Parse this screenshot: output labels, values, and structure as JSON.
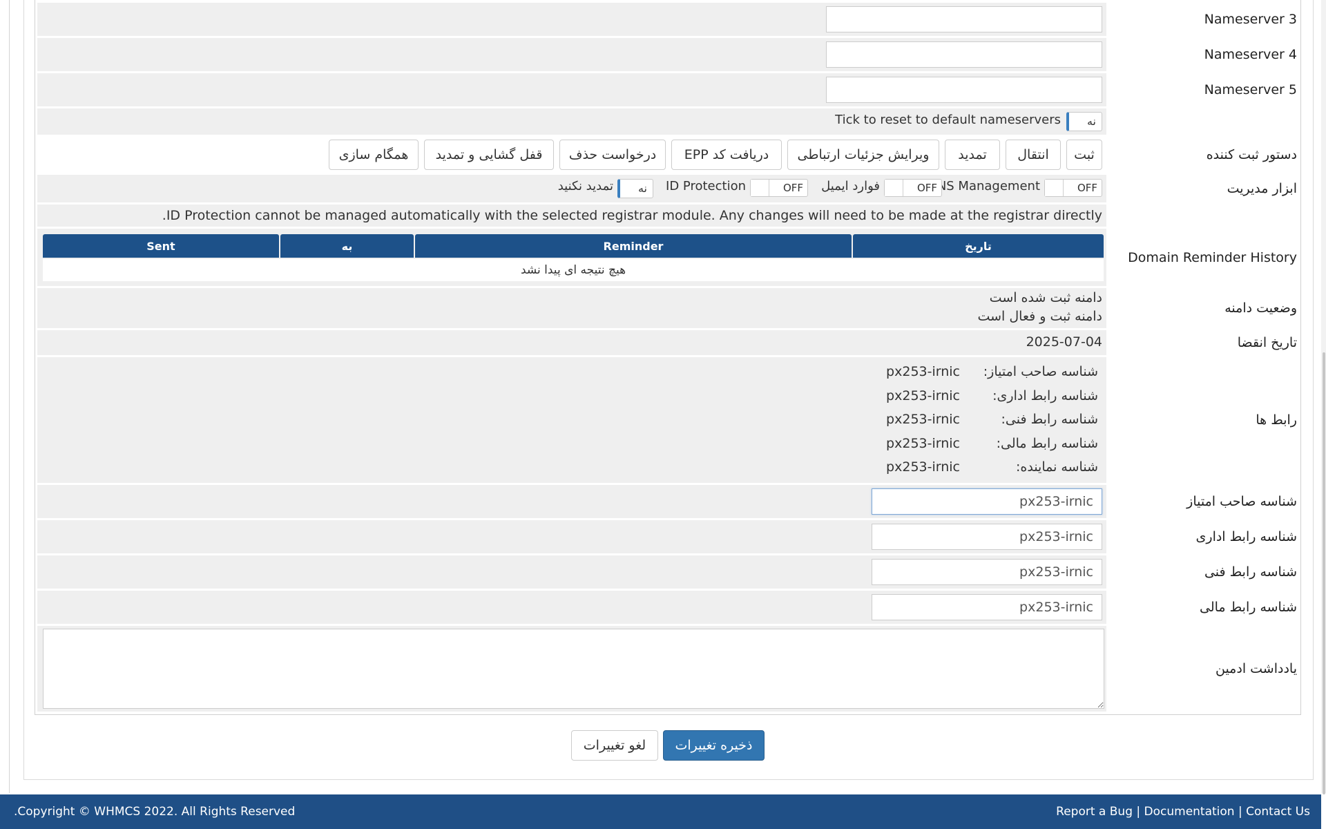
{
  "nameservers": [
    {
      "label": "Nameserver 3",
      "value": ""
    },
    {
      "label": "Nameserver 4",
      "value": ""
    },
    {
      "label": "Nameserver 5",
      "value": ""
    }
  ],
  "reset_ns": {
    "toggle_label": "نه",
    "text": "Tick to reset to default nameservers"
  },
  "registrar_commands": {
    "label": "دستور ثبت کننده",
    "buttons": [
      "ثبت",
      "انتقال",
      "تمدید",
      "ویرایش جزئیات ارتباطی",
      "دریافت کد EPP",
      "درخواست حذف",
      "قفل گشایی و تمدید",
      "همگام سازی"
    ]
  },
  "management_tools": {
    "label": "ابزار مدیریت",
    "off_text": "OFF",
    "dns": "DNS Management",
    "email_forward": "فوارد ایمیل",
    "id_protection": "ID Protection",
    "no_renew_toggle": "نه",
    "no_renew": "تمدید نکنید"
  },
  "id_protection_notice": "ID Protection cannot be managed automatically with the selected registrar module. Any changes will need to be made at the registrar directly.",
  "reminder_history": {
    "label": "Domain Reminder History",
    "columns": [
      "تاریخ",
      "Reminder",
      "به",
      "Sent"
    ],
    "empty": "هیچ نتیجه ای پیدا نشد"
  },
  "domain_status": {
    "label": "وضعیت دامنه",
    "lines": [
      "دامنه ثبت شده است",
      "دامنه ثبت و فعال است"
    ]
  },
  "expiry": {
    "label": "تاریخ انقضا",
    "value": "2025-07-04"
  },
  "contacts": {
    "label": "رابط ها",
    "items": [
      {
        "k": "شناسه صاحب امتیاز:",
        "v": "px253-irnic"
      },
      {
        "k": "شناسه رابط اداری:",
        "v": "px253-irnic"
      },
      {
        "k": "شناسه رابط فنی:",
        "v": "px253-irnic"
      },
      {
        "k": "شناسه رابط مالی:",
        "v": "px253-irnic"
      },
      {
        "k": "شناسه نماینده:",
        "v": "px253-irnic"
      }
    ]
  },
  "contact_fields": [
    {
      "label": "شناسه صاحب امتیاز",
      "value": "px253-irnic"
    },
    {
      "label": "شناسه رابط اداری",
      "value": "px253-irnic"
    },
    {
      "label": "شناسه رابط فنی",
      "value": "px253-irnic"
    },
    {
      "label": "شناسه رابط مالی",
      "value": "px253-irnic"
    }
  ],
  "admin_notes": {
    "label": "یادداشت ادمین",
    "value": ""
  },
  "actions": {
    "save": "ذخیره تغییرات",
    "cancel": "لغو تغییرات"
  },
  "footer": {
    "copyright": "Copyright © WHMCS 2022. All Rights Reserved.",
    "report_bug": "Report a Bug",
    "documentation": "Documentation",
    "contact": "Contact Us",
    "separator": "|"
  }
}
